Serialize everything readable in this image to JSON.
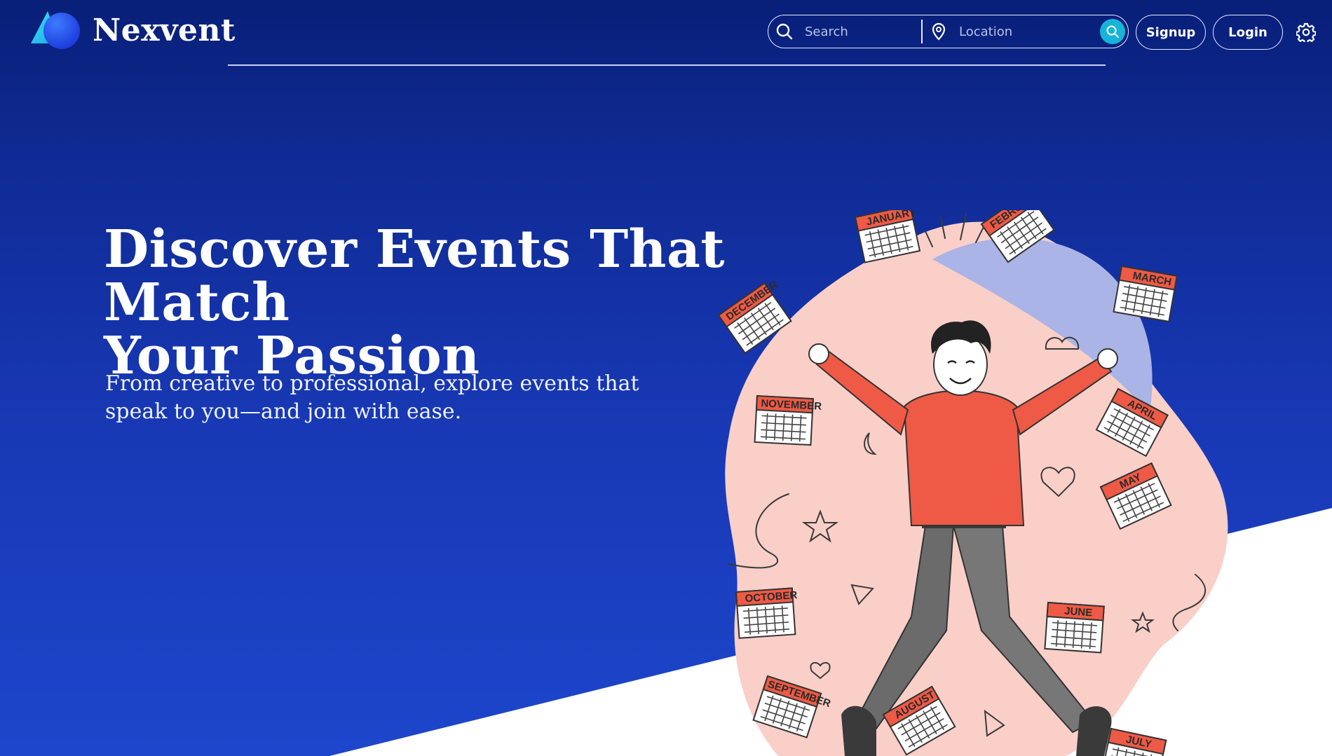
{
  "brand": {
    "name": "Nexvent"
  },
  "search": {
    "keyword_placeholder": "Search",
    "location_placeholder": "Location",
    "icons": {
      "search": "search-icon",
      "location": "map-pin-icon",
      "submit": "search-icon"
    }
  },
  "nav": {
    "signup_label": "Signup",
    "login_label": "Login",
    "settings_icon": "gear-icon"
  },
  "hero": {
    "title_line1": "Discover Events That Match",
    "title_line2": "Your Passion",
    "subtitle_line1": "From creative to professional, explore events that",
    "subtitle_line2": "speak to you—and join with ease."
  },
  "illustration": {
    "months": [
      "JANUARY",
      "FEBRUARY",
      "MARCH",
      "APRIL",
      "MAY",
      "JUNE",
      "JULY",
      "AUGUST",
      "SEPTEMBER",
      "OCTOBER",
      "NOVEMBER",
      "DECEMBER"
    ]
  },
  "colors": {
    "background_top": "#081f78",
    "background_bottom": "#1d46cc",
    "accent": "#16b4d8",
    "illustration_red": "#ee5a45",
    "blob_pink": "#f9cfc8"
  }
}
